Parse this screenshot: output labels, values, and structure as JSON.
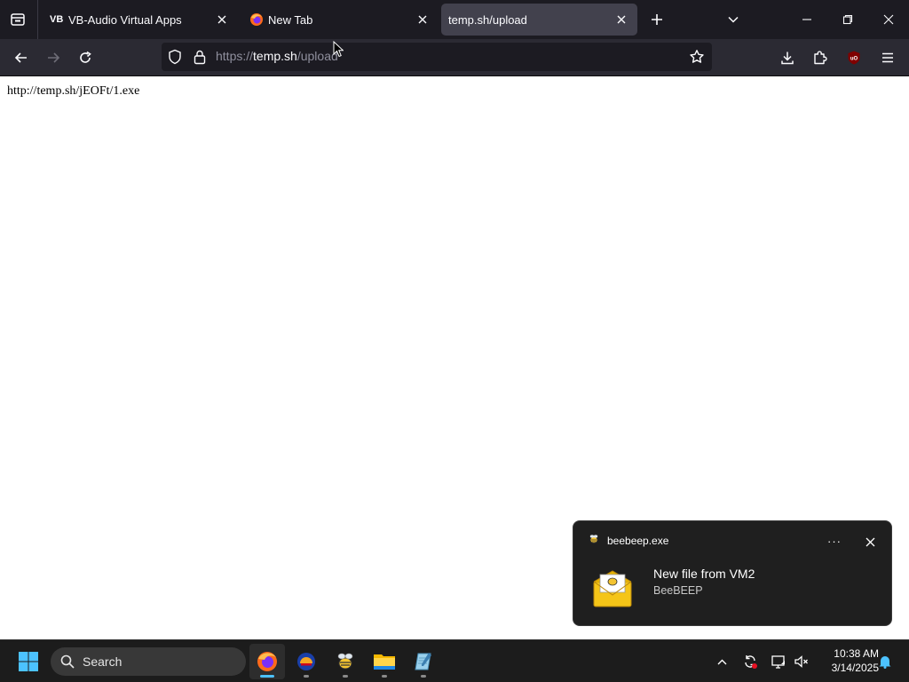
{
  "browser": {
    "tabs": [
      {
        "label": "VB-Audio Virtual Apps",
        "favicon": "vb-audio-icon",
        "active": false
      },
      {
        "label": "New Tab",
        "favicon": "firefox-icon",
        "active": false
      },
      {
        "label": "temp.sh/upload",
        "favicon": "",
        "active": true
      }
    ],
    "url_prefix": "https://",
    "url_domain": "temp.sh",
    "url_path": "/upload"
  },
  "page": {
    "text": "http://temp.sh/jEOFt/1.exe"
  },
  "notification": {
    "app_name": "beebeep.exe",
    "title": "New file from VM2",
    "body": "BeeBEEP"
  },
  "taskbar": {
    "search_label": "Search",
    "apps": [
      "firefox",
      "app-circle",
      "beebeep",
      "file-explorer",
      "notepad"
    ],
    "time": "10:38 AM",
    "date": "3/14/2025"
  },
  "colors": {
    "tab_strip": "#1c1b22",
    "toolbar": "#2b2a33",
    "active_tab": "#42414d",
    "taskbar": "#1c1c1c",
    "accent": "#4cc2ff"
  }
}
